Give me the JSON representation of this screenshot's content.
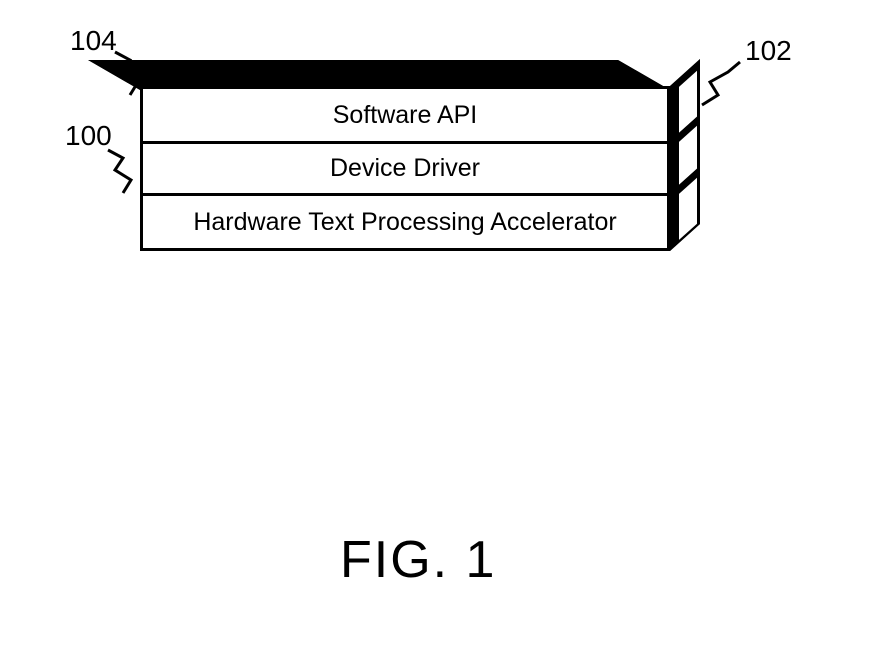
{
  "layers": {
    "top": {
      "label": "Software API",
      "ref": "104"
    },
    "middle": {
      "label": "Device Driver",
      "ref": "102"
    },
    "bottom": {
      "label": "Hardware Text Processing Accelerator",
      "ref": "100"
    }
  },
  "figure": "FIG. 1"
}
